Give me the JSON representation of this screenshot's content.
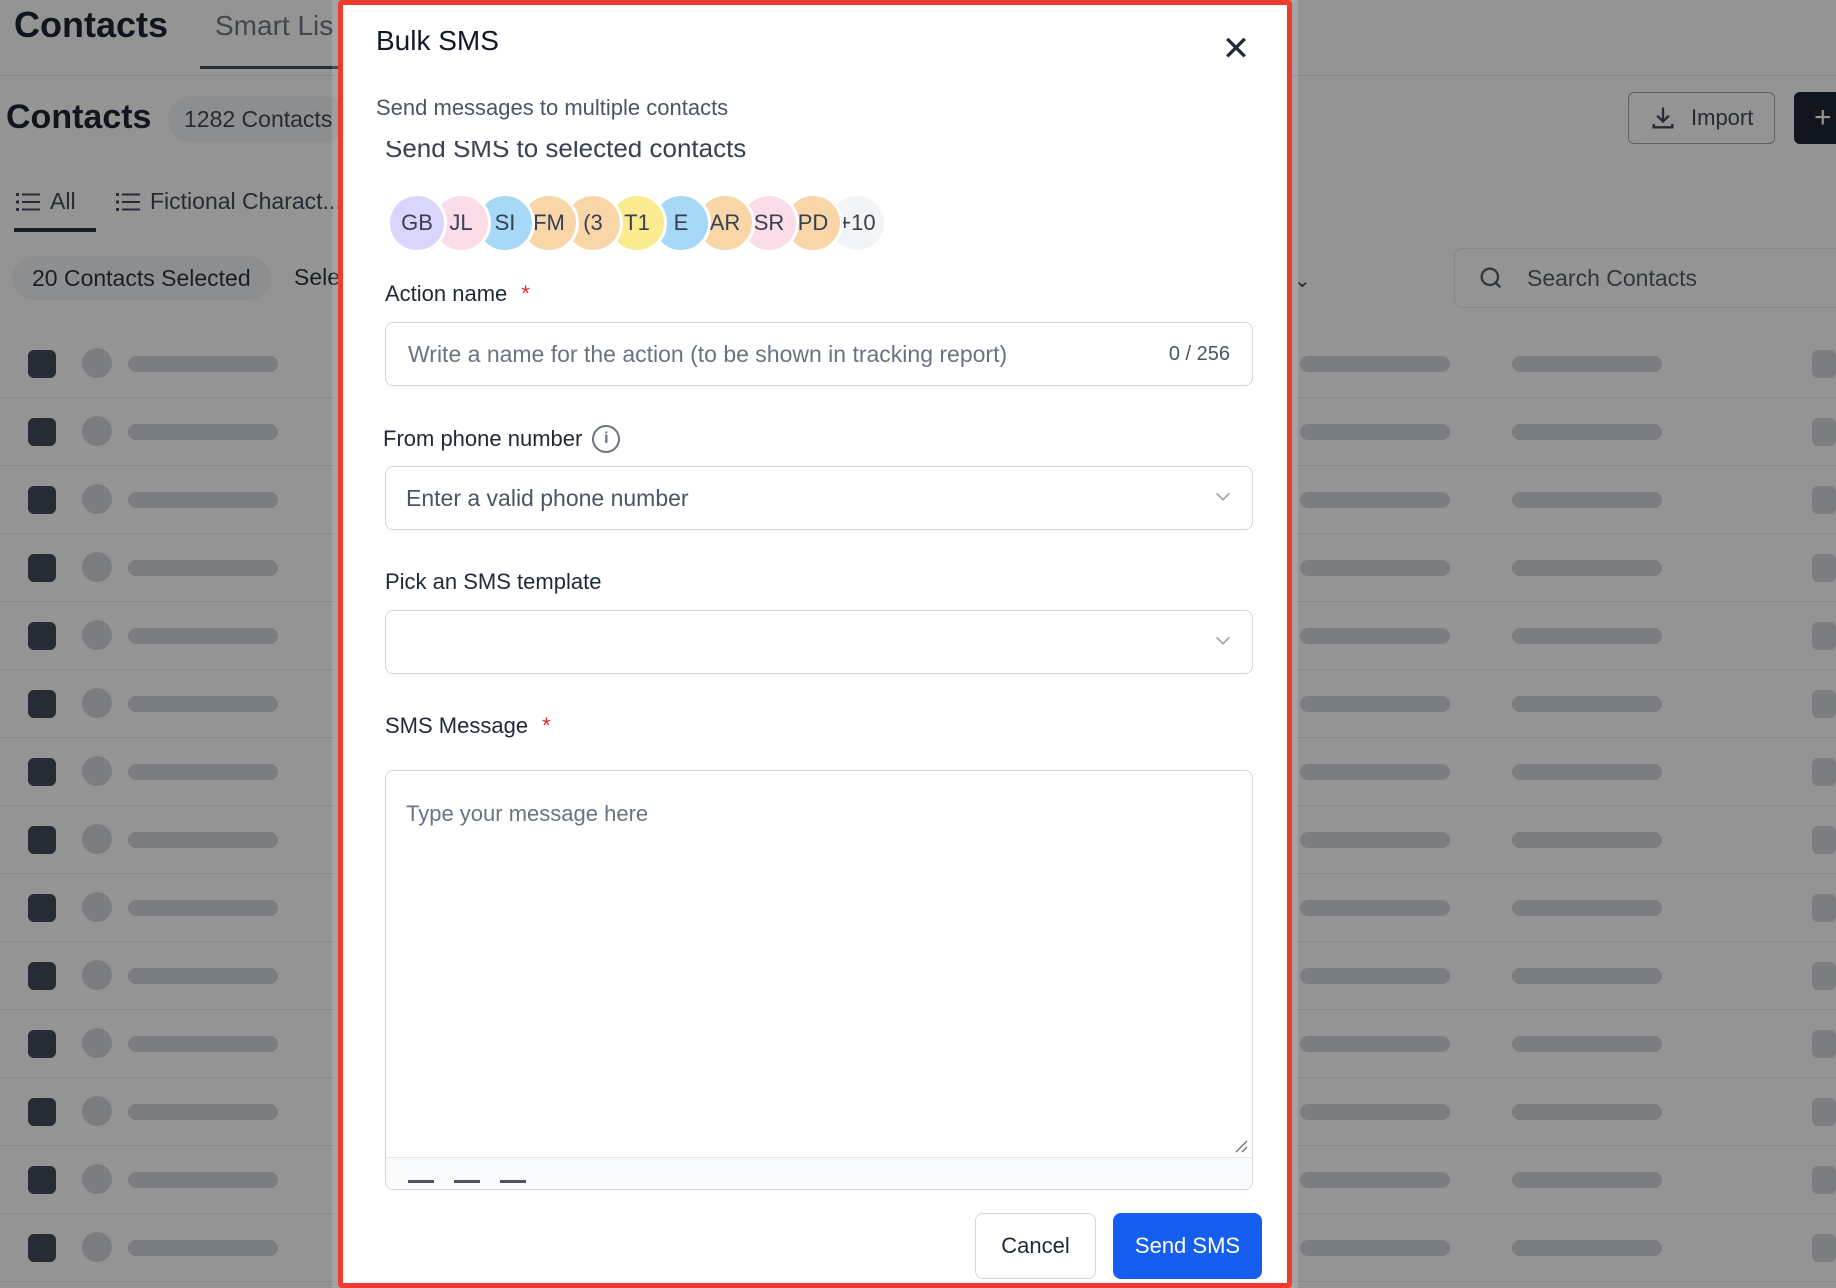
{
  "background": {
    "app_title": "Contacts",
    "tab_smart_lists": "Smart Lis",
    "page_heading": "Contacts",
    "contact_count": "1282 Contacts",
    "import_label": "Import",
    "add_label": "+",
    "list_all": "All",
    "list_fictional": "Fictional Charact...",
    "selected_pill": "20 Contacts Selected",
    "select_more": "Sele",
    "search_placeholder": "Search Contacts"
  },
  "modal": {
    "title": "Bulk SMS",
    "close_glyph": "✕",
    "subtitle": "Send messages to multiple contacts",
    "section_cut": "Send SMS to selected contacts",
    "avatars": [
      {
        "initials": "GB",
        "color": "#d9d5fb"
      },
      {
        "initials": "JL",
        "color": "#fbdde9"
      },
      {
        "initials": "SI",
        "color": "#a7d8f7"
      },
      {
        "initials": "FM",
        "color": "#f9d6a8"
      },
      {
        "initials": "(3",
        "color": "#f9d6a8"
      },
      {
        "initials": "T1",
        "color": "#fbeb8f"
      },
      {
        "initials": "E",
        "color": "#a7d8f7"
      },
      {
        "initials": "AR",
        "color": "#f9d6a8"
      },
      {
        "initials": "SR",
        "color": "#fbdde9"
      },
      {
        "initials": "PD",
        "color": "#f9d6a8"
      },
      {
        "initials": "+10",
        "color": "#f3f4f6"
      }
    ],
    "action_name": {
      "label": "Action name",
      "required_mark": "*",
      "value": "",
      "placeholder": "Write a name for the action (to be shown in tracking report)",
      "counter": "0 / 256"
    },
    "phone": {
      "label": "From phone number",
      "info_glyph": "i",
      "placeholder": "Enter a valid phone number"
    },
    "template": {
      "label": "Pick an SMS template",
      "value": ""
    },
    "message": {
      "label": "SMS Message",
      "required_mark": "*",
      "value": "",
      "placeholder": "Type your message here"
    },
    "cancel_label": "Cancel",
    "send_label": "Send SMS"
  }
}
